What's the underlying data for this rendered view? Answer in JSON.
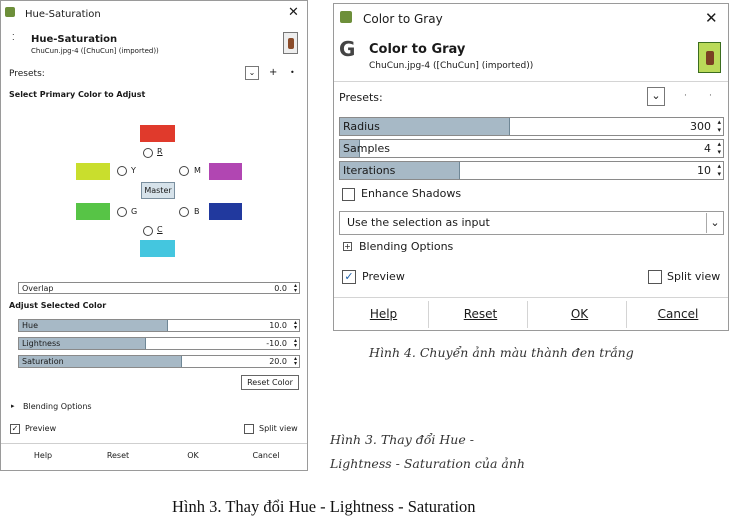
{
  "left_dialog": {
    "window_title": "Hue-Saturation",
    "header_title": "Hue-Saturation",
    "header_subtitle": "ChuCun.jpg-4 ([ChuCun] (imported))",
    "presets_label": "Presets:",
    "presets_add": "+",
    "presets_menu": "•",
    "primary_heading": "Select Primary Color to Adjust",
    "colors": {
      "R": {
        "label": "R",
        "color": "#e03a2c"
      },
      "Y": {
        "label": "Y",
        "color": "#c9de2d"
      },
      "M": {
        "label": "M",
        "color": "#b146b2"
      },
      "G": {
        "label": "G",
        "color": "#57c446"
      },
      "B": {
        "label": "B",
        "color": "#21399e"
      },
      "C": {
        "label": "C",
        "color": "#44c6df"
      }
    },
    "master_label": "Master",
    "overlap": {
      "label": "Overlap",
      "value": "0.0",
      "level": 0.0
    },
    "adjust_heading": "Adjust Selected Color",
    "hue": {
      "label": "Hue",
      "value": "10.0",
      "level": 0.53
    },
    "lightness": {
      "label": "Lightness",
      "value": "-10.0",
      "level": 0.45
    },
    "saturation": {
      "label": "Saturation",
      "value": "20.0",
      "level": 0.58
    },
    "reset_color": "Reset Color",
    "blending": "Blending Options",
    "preview": "Preview",
    "split_view": "Split view",
    "buttons": {
      "help": "Help",
      "reset": "Reset",
      "ok": "OK",
      "cancel": "Cancel"
    }
  },
  "right_dialog": {
    "window_title": "Color to Gray",
    "header_title": "Color to Gray",
    "header_subtitle": "ChuCun.jpg-4 ([ChuCun] (imported))",
    "presets_label": "Presets:",
    "radius": {
      "label": "Radius",
      "value": "300",
      "level": 0.44
    },
    "samples": {
      "label": "Samples",
      "value": "4",
      "level": 0.05
    },
    "iterations": {
      "label": "Iterations",
      "value": "10",
      "level": 0.31
    },
    "enhance_shadows": "Enhance Shadows",
    "selection_dropdown": "Use the selection as input",
    "blending": "Blending Options",
    "preview": "Preview",
    "split_view": "Split view",
    "buttons": {
      "help": "Help",
      "reset": "Reset",
      "ok": "OK",
      "cancel": "Cancel"
    }
  },
  "captions": {
    "right_caption": "Hình 4. Chuyển ảnh màu thành đen trắng",
    "left_caption_line1": "Hình 3. Thay đổi Hue -",
    "left_caption_line2": "Lightness - Saturation của ảnh",
    "bottom_caption": "Hình 3. Thay đổi Hue - Lightness - Saturation"
  }
}
